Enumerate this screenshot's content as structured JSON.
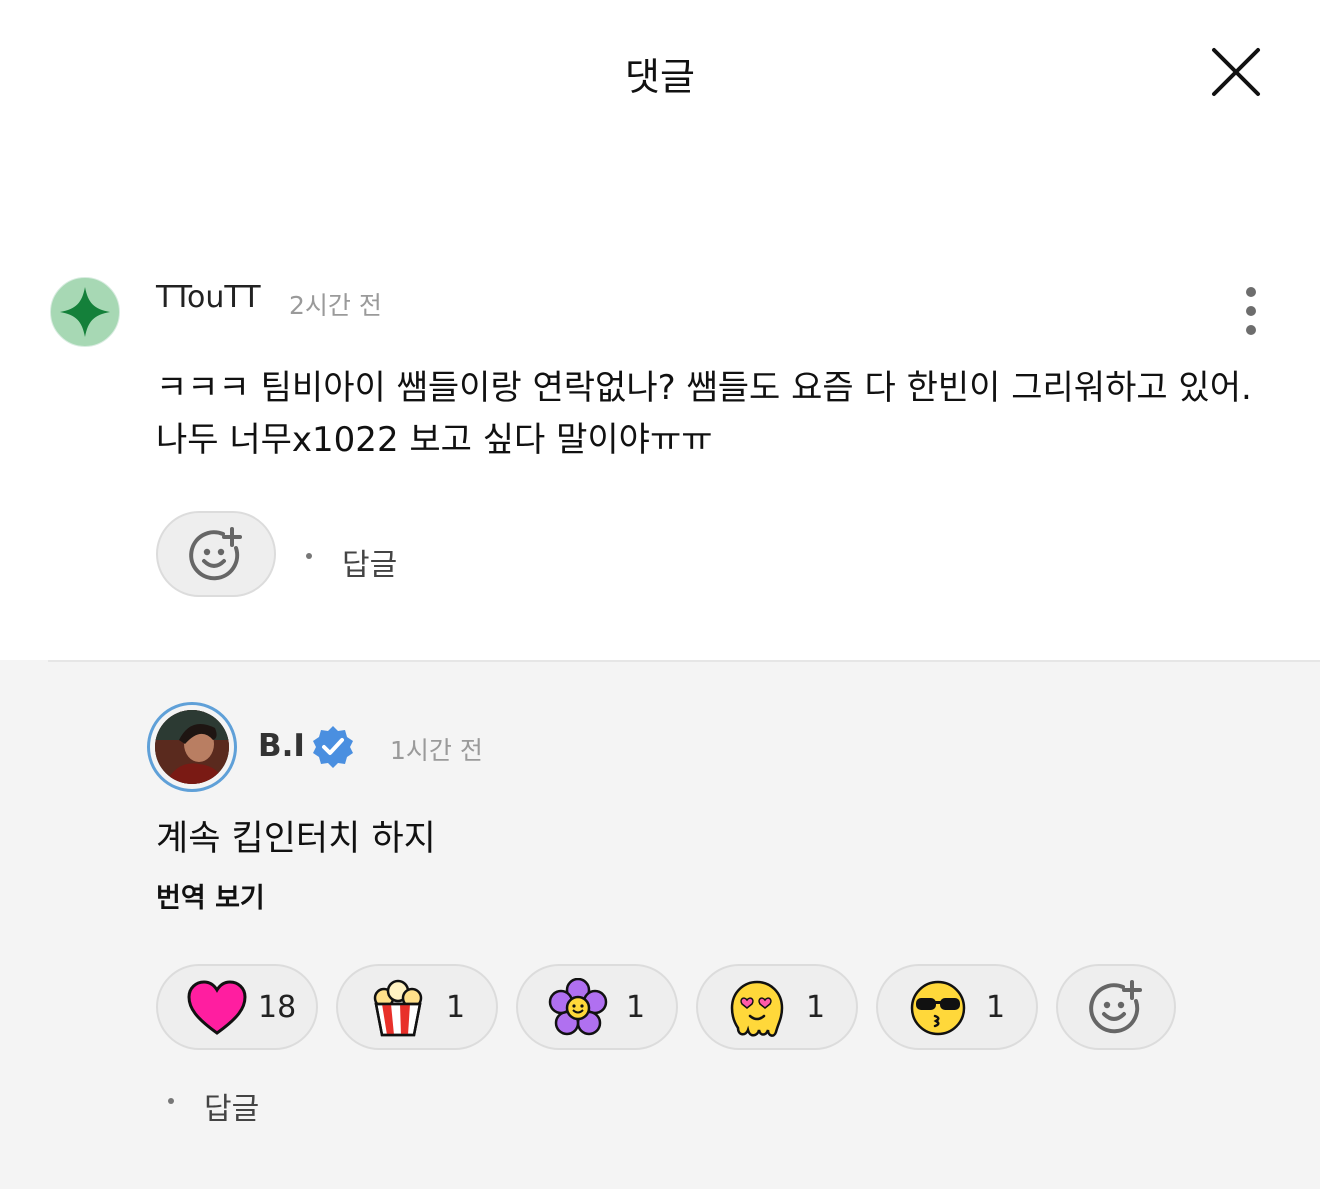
{
  "header": {
    "title": "댓글",
    "close_icon": "close-icon"
  },
  "comment": {
    "author": "TTouTT",
    "time": "2시간 전",
    "line1": "ㅋㅋㅋ 팀비아이 쌤들이랑 연락없나? 쌤들도 요즘 다 한빈이 그리워하고 있어.",
    "line2": "나두 너무x1022 보고 싶다 말이야ㅠㅠ",
    "reply_label": "답글",
    "avatar_icon": "green-sparkle-icon",
    "more_icon": "more-vertical-icon",
    "add_reaction_icon": "add-reaction-icon"
  },
  "reply": {
    "author": "B.I",
    "verified_icon": "verified-badge-icon",
    "time": "1시간 전",
    "text": "계속 킵인터치 하지",
    "translate_label": "번역 보기",
    "reply_label": "답글",
    "reactions": [
      {
        "icon": "heart-icon",
        "count": "18",
        "color": "#ff1ea0"
      },
      {
        "icon": "popcorn-icon",
        "count": "1"
      },
      {
        "icon": "flower-icon",
        "count": "1"
      },
      {
        "icon": "melting-heart-eyes-icon",
        "count": "1"
      },
      {
        "icon": "sunglasses-kiss-icon",
        "count": "1"
      }
    ]
  },
  "colors": {
    "accent_blue": "#4a8fe0",
    "avatar_green": "#a7d8b4",
    "star_green": "#14803a",
    "reply_bg": "#f4f4f4"
  }
}
